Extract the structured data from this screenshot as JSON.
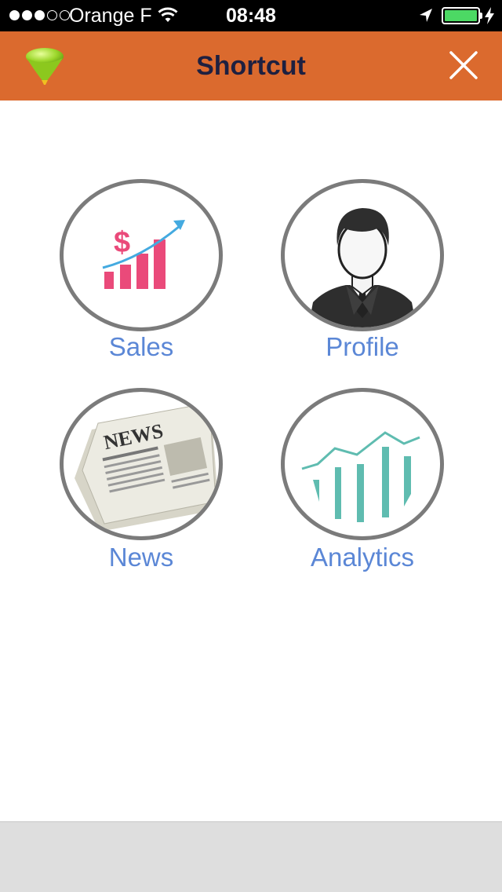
{
  "status_bar": {
    "carrier": "Orange F",
    "time": "08:48",
    "signal_bars_filled": 3,
    "signal_bars_total": 5,
    "battery_level": 1.0,
    "battery_color": "#4cd964"
  },
  "nav": {
    "title": "Shortcut",
    "bar_color": "#db6a2e",
    "title_color": "#1e2040"
  },
  "shortcuts": [
    {
      "label": "Sales",
      "icon": "sales-chart-icon"
    },
    {
      "label": "Profile",
      "icon": "businessman-icon"
    },
    {
      "label": "News",
      "icon": "newspaper-icon"
    },
    {
      "label": "Analytics",
      "icon": "analytics-chart-icon"
    }
  ],
  "colors": {
    "label": "#5b87d6",
    "circle_border": "#7b7b7b",
    "footer": "#dedede"
  }
}
